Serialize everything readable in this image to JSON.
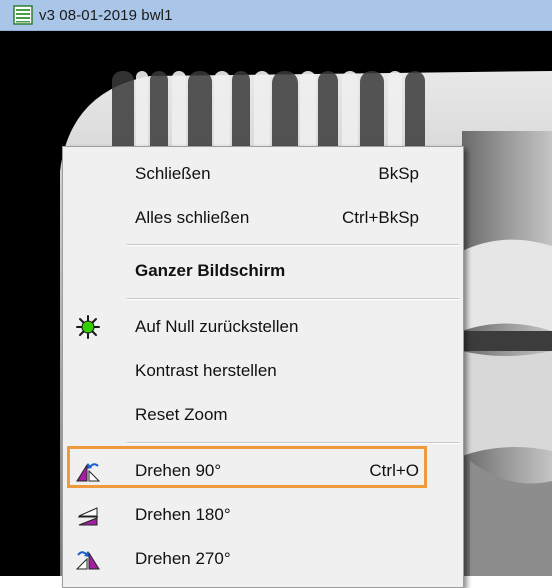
{
  "window": {
    "title": "v3  08-01-2019  bwl1",
    "icon": "document-list-icon"
  },
  "menu": {
    "items": [
      {
        "label": "Schließen",
        "shortcut": "BkSp"
      },
      {
        "label": "Alles schließen",
        "shortcut": "Ctrl+BkSp"
      },
      {
        "label": "Ganzer Bildschirm",
        "bold": true
      },
      {
        "label": "Auf Null zurückstellen",
        "icon": "reset-star-icon"
      },
      {
        "label": "Kontrast herstellen"
      },
      {
        "label": "Reset Zoom"
      },
      {
        "label": "Drehen 90°",
        "shortcut": "Ctrl+O",
        "icon": "rotate-90-icon",
        "highlighted": true
      },
      {
        "label": "Drehen 180°",
        "icon": "rotate-180-icon"
      },
      {
        "label": "Drehen 270°",
        "icon": "rotate-270-icon"
      }
    ]
  },
  "colors": {
    "title_bar": "#a9c6e8",
    "highlight_border": "#ef9a3a",
    "menu_background": "#f0f0f0",
    "reset_icon": "#35d000"
  }
}
